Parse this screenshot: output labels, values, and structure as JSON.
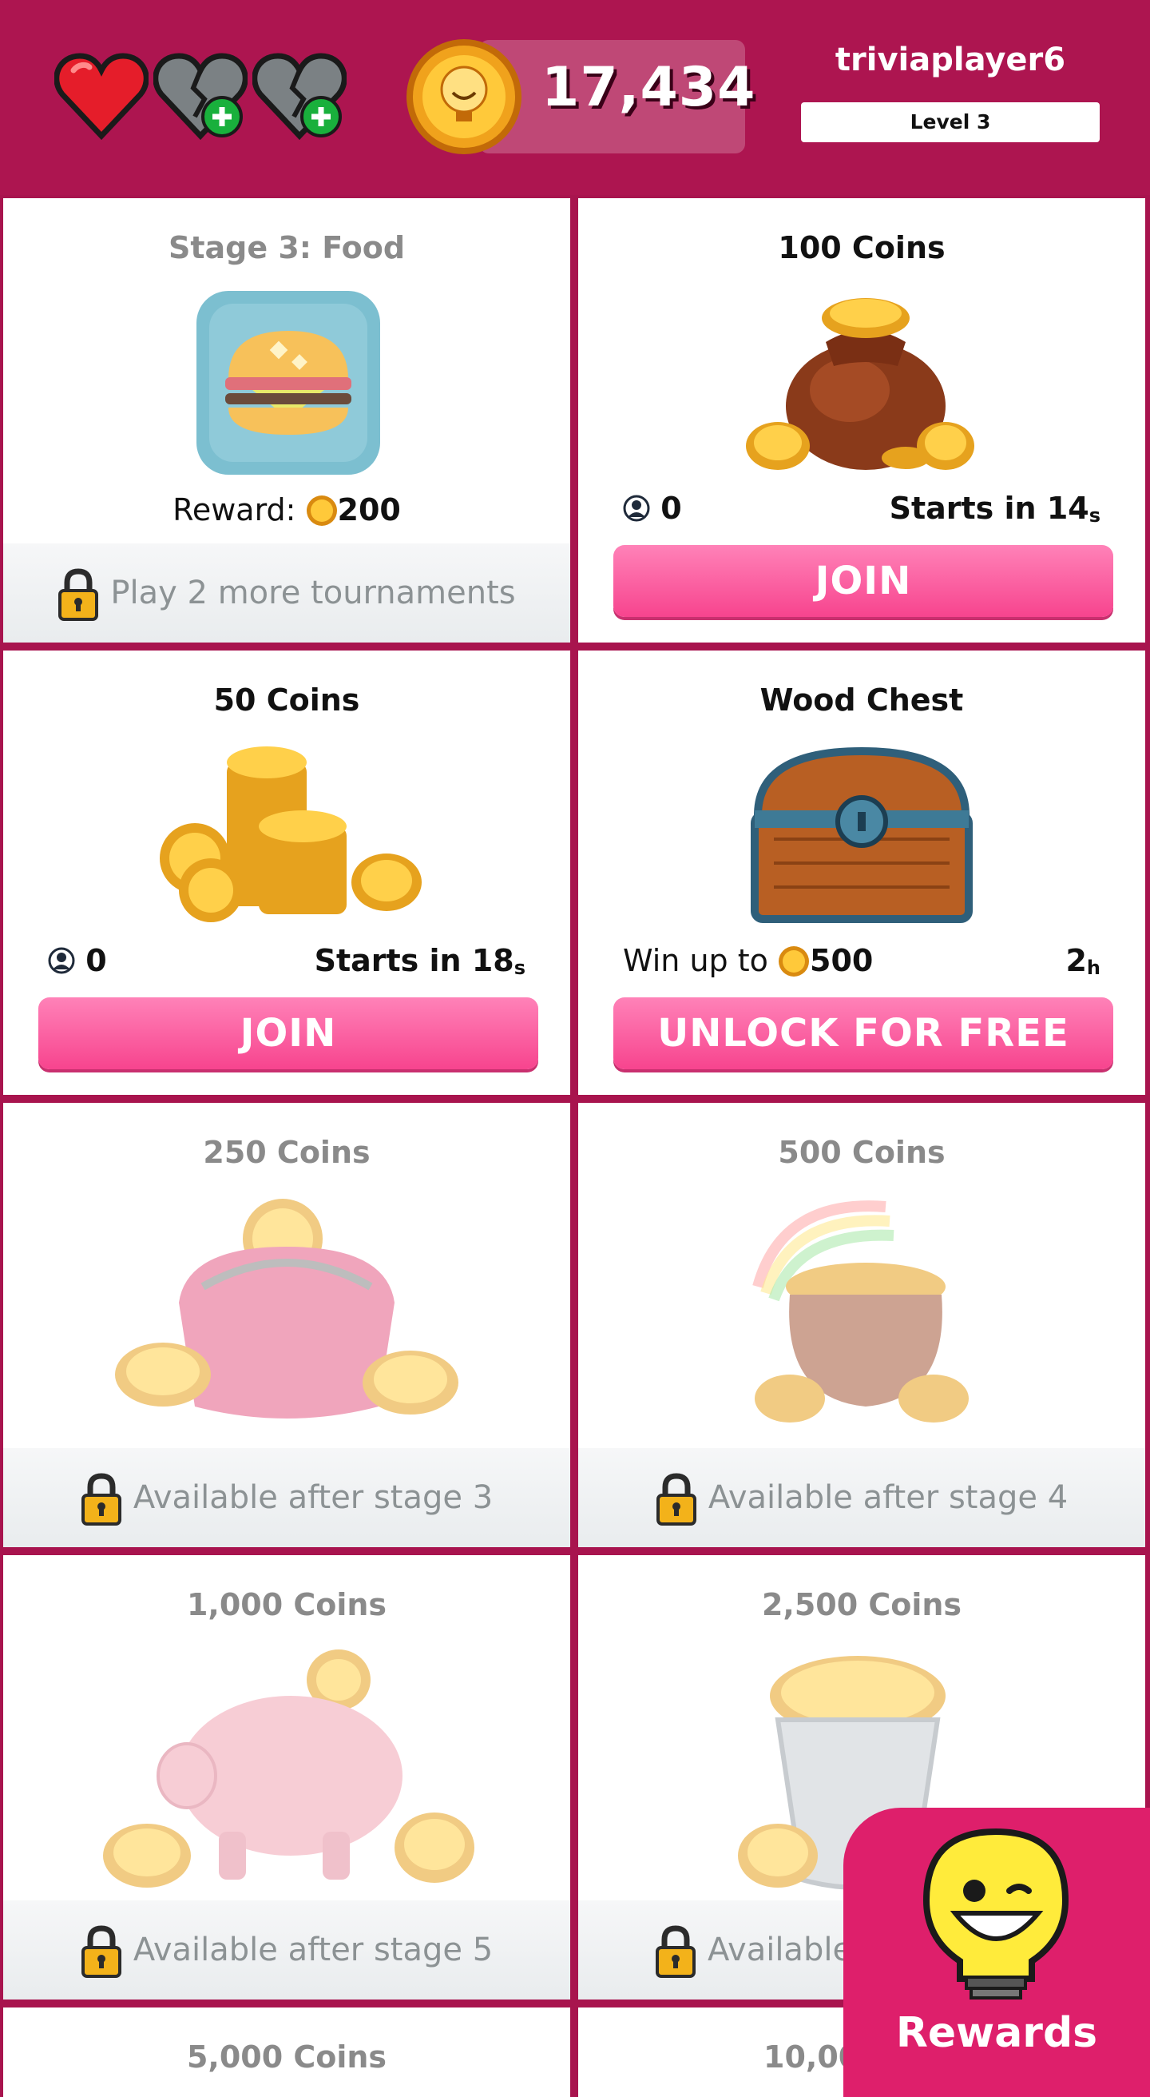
{
  "header": {
    "lives": [
      {
        "state": "full",
        "icon": "heart-icon"
      },
      {
        "state": "empty",
        "icon": "broken-heart-add-icon"
      },
      {
        "state": "empty",
        "icon": "broken-heart-add-icon"
      }
    ],
    "coins": "17,434",
    "username": "triviaplayer6",
    "level": "Level 3"
  },
  "cards": {
    "stage": {
      "title": "Stage 3: Food",
      "reward_label": "Reward:",
      "reward_value": "200",
      "footer": "Play 2 more tournaments"
    },
    "c100": {
      "title": "100 Coins",
      "players": "0",
      "starts": "Starts in 14",
      "unit": "s",
      "button": "JOIN"
    },
    "c50": {
      "title": "50 Coins",
      "players": "0",
      "starts": "Starts in 18",
      "unit": "s",
      "button": "JOIN"
    },
    "chest": {
      "title": "Wood Chest",
      "win_label": "Win up to",
      "win_value": "500",
      "time": "2",
      "unit": "h",
      "button": "UNLOCK FOR FREE"
    },
    "c250": {
      "title": "250 Coins",
      "footer": "Available after stage 3"
    },
    "c500": {
      "title": "500 Coins",
      "footer": "Available after stage 4"
    },
    "c1000": {
      "title": "1,000 Coins",
      "footer": "Available after stage 5"
    },
    "c2500": {
      "title": "2,500 Coins",
      "footer": "Available"
    },
    "c5000": {
      "title": "5,000 Coins"
    },
    "c10000": {
      "title": "10,00"
    }
  },
  "rewards": {
    "label": "Rewards"
  },
  "colors": {
    "header": "#ad1550",
    "grid": "#a8144e",
    "button": "#f7448e",
    "rewards": "#de1f6b"
  }
}
